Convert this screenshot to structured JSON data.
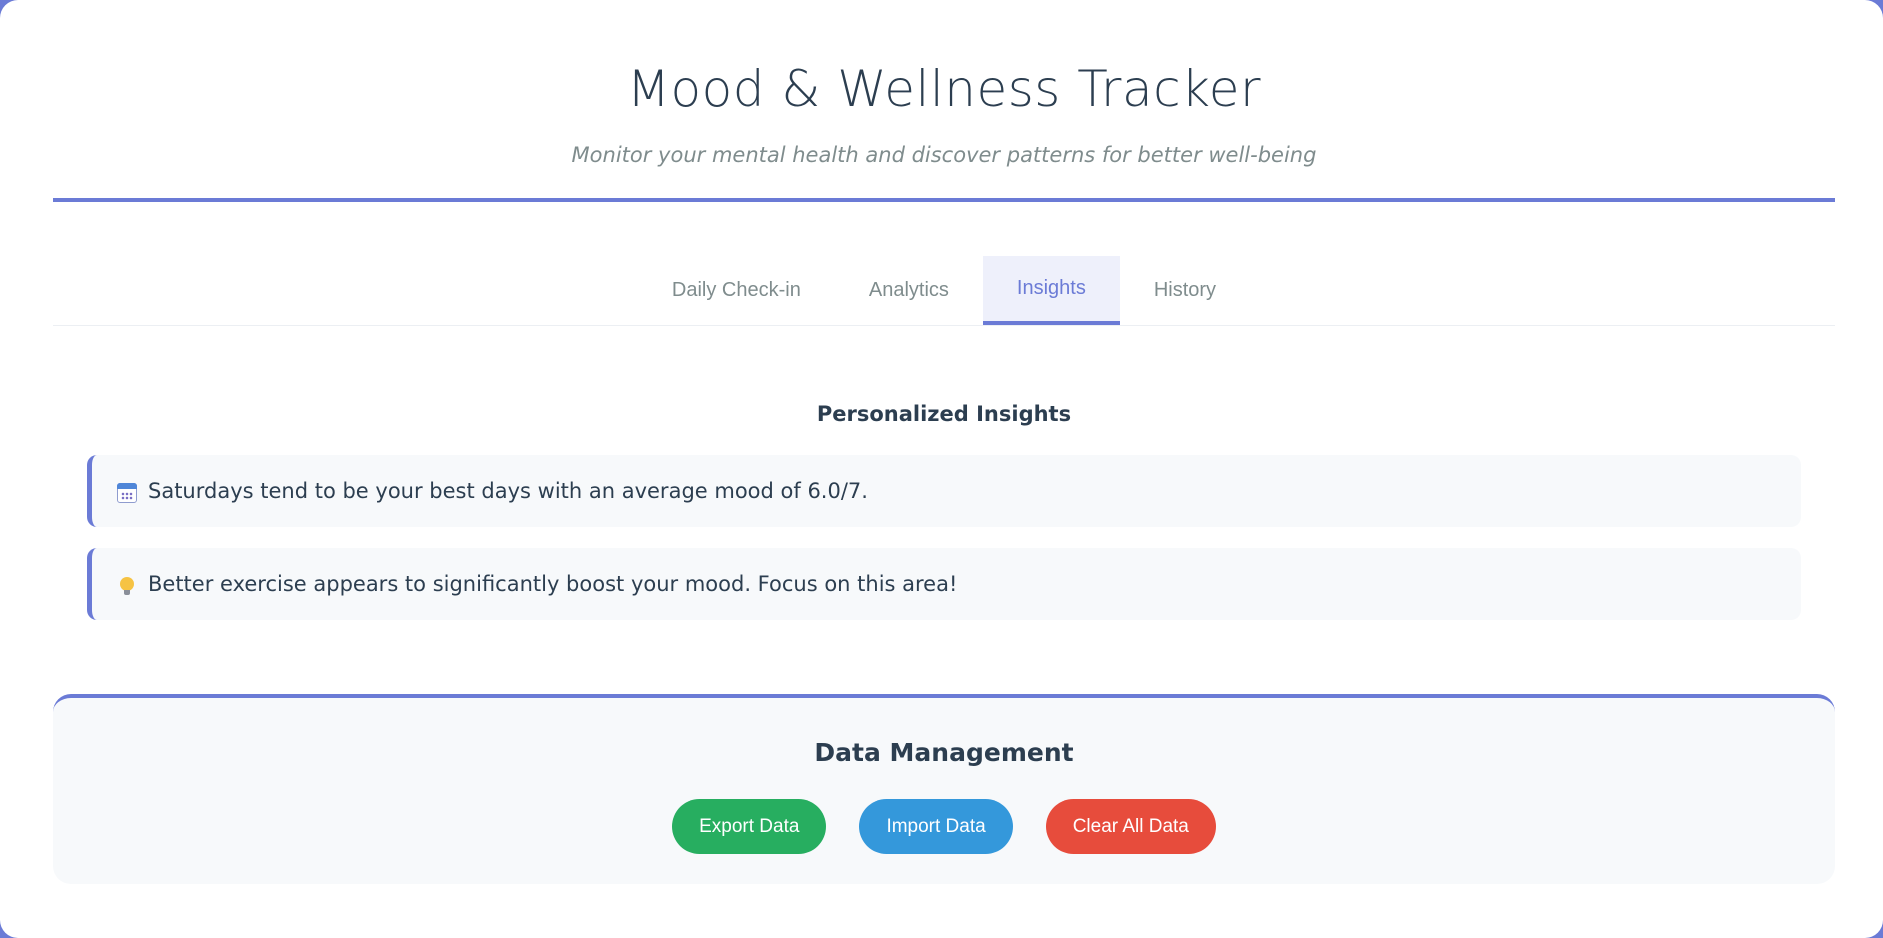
{
  "header": {
    "title": "Mood & Wellness Tracker",
    "subtitle": "Monitor your mental health and discover patterns for better well-being"
  },
  "tabs": [
    {
      "label": "Daily Check-in",
      "active": false
    },
    {
      "label": "Analytics",
      "active": false
    },
    {
      "label": "Insights",
      "active": true
    },
    {
      "label": "History",
      "active": false
    }
  ],
  "insights": {
    "title": "Personalized Insights",
    "items": [
      {
        "icon": "calendar-icon",
        "text": "Saturdays tend to be your best days with an average mood of 6.0/7."
      },
      {
        "icon": "lightbulb-icon",
        "text": "Better exercise appears to significantly boost your mood. Focus on this area!"
      }
    ]
  },
  "data_management": {
    "title": "Data Management",
    "export_label": "Export Data",
    "import_label": "Import Data",
    "clear_label": "Clear All Data"
  },
  "colors": {
    "accent": "#6b7bd6",
    "export": "#27ae60",
    "import": "#3498db",
    "clear": "#e74c3c",
    "text": "#2c3e50",
    "muted": "#7f8c8d"
  }
}
